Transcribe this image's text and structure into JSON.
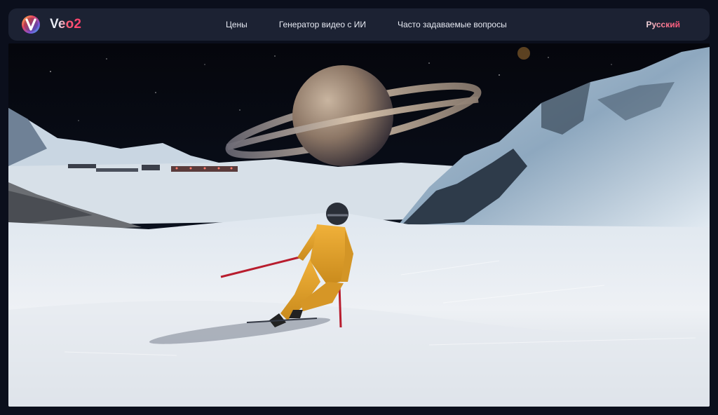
{
  "brand": {
    "name": "Veo2",
    "logo_icon": "veo-v-logo-icon"
  },
  "nav": {
    "items": [
      {
        "label": "Цены"
      },
      {
        "label": "Генератор видео с ИИ"
      },
      {
        "label": "Часто задаваемые вопросы"
      }
    ]
  },
  "language": {
    "selected": "Русский"
  },
  "colors": {
    "navbar_bg": "#1c2233",
    "page_bg": "#0b0f1c",
    "accent": "#ff4f6e",
    "nav_text": "#e6e9f2"
  }
}
